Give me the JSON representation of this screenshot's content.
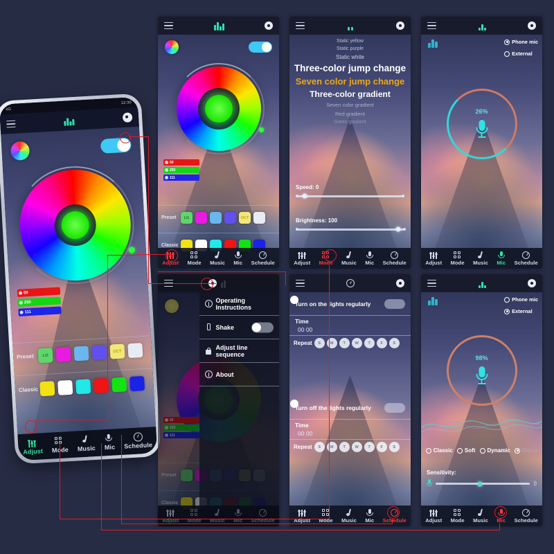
{
  "background_color": "#272c45",
  "accent_green": "#2ee39f",
  "accent_red": "#ff3b3b",
  "accent_orange": "#f0a810",
  "nav": {
    "items": [
      {
        "label": "Adjust",
        "icon": "sliders-icon"
      },
      {
        "label": "Mode",
        "icon": "grid-icon"
      },
      {
        "label": "Music",
        "icon": "music-note-icon"
      },
      {
        "label": "Mic",
        "icon": "microphone-icon"
      },
      {
        "label": "Schedule",
        "icon": "clock-icon"
      }
    ]
  },
  "big_phone": {
    "status_bar": {
      "left": "4G",
      "right": "12:30"
    },
    "screen": "adjust"
  },
  "adjust": {
    "rgb": [
      {
        "channel": "R",
        "value": "50",
        "color": "#e81515"
      },
      {
        "channel": "G",
        "value": "250",
        "color": "#15d615"
      },
      {
        "channel": "B",
        "value": "111",
        "color": "#1c26e8"
      }
    ],
    "preset_label": "Preset",
    "classic_label": "Classic",
    "preset_swatches": [
      {
        "color": "#5fd66b",
        "text": "LG"
      },
      {
        "color": "#e81ce0",
        "text": ""
      },
      {
        "color": "#6bb6ee",
        "text": ""
      },
      {
        "color": "#6150ee",
        "text": ""
      },
      {
        "color": "#f2e87a",
        "text": "OCT"
      },
      {
        "color": "#e8ecf2",
        "text": ""
      }
    ],
    "classic_swatches": [
      {
        "color": "#f2e214",
        "text": ""
      },
      {
        "color": "#ffffff",
        "text": ""
      },
      {
        "color": "#22e8e8",
        "text": ""
      },
      {
        "color": "#f01414",
        "text": ""
      },
      {
        "color": "#13e213",
        "text": ""
      },
      {
        "color": "#1a22e8",
        "text": ""
      }
    ],
    "power_toggle": "on",
    "color_wheel_icon": "color-wheel-icon"
  },
  "mode": {
    "items": [
      {
        "label": "Static yellow",
        "style": "dim"
      },
      {
        "label": "Static purple",
        "style": "dim"
      },
      {
        "label": "Static white",
        "style": "dim2"
      },
      {
        "label": "Three-color jump change",
        "style": "big"
      },
      {
        "label": "Seven color jump change",
        "style": "selected"
      },
      {
        "label": "Three-color gradient",
        "style": "big2"
      },
      {
        "label": "Seven color gradient",
        "style": "faint"
      },
      {
        "label": "Red gradient",
        "style": "faint"
      },
      {
        "label": "Green gradient",
        "style": "faint2"
      }
    ],
    "speed": {
      "label": "Speed:",
      "value": "0",
      "position_pct": 8
    },
    "brightness": {
      "label": "Brightness:",
      "value": "100",
      "position_pct": 94
    }
  },
  "mic_top": {
    "source_options": [
      {
        "label": "Phone mic",
        "selected": true
      },
      {
        "label": "External",
        "selected": false
      }
    ],
    "percent": "26%",
    "ring_color": "#2fd9d9",
    "eq_icon": "equalizer-icon",
    "mic_icon": "microphone-icon"
  },
  "mic_bottom": {
    "source_options": [
      {
        "label": "Phone mic",
        "selected": false
      },
      {
        "label": "External",
        "selected": true
      }
    ],
    "percent": "98%",
    "ring_color": "#cf8166",
    "eq_icon": "equalizer-icon",
    "mic_icon": "microphone-icon",
    "effect_options": [
      {
        "label": "Classic",
        "selected": false
      },
      {
        "label": "Soft",
        "selected": false
      },
      {
        "label": "Dynamic",
        "selected": false
      },
      {
        "label": "Disco",
        "selected": true
      }
    ],
    "sensitivity": {
      "label": "Sensitivity:",
      "position_pct": 47,
      "left_icon": "microphone-icon",
      "right_icon": "speaker-icon"
    }
  },
  "settings_menu": {
    "items": [
      {
        "label": "Operating Instructions",
        "icon": "question-circle-icon",
        "toggle": false
      },
      {
        "label": "Shake",
        "icon": "shake-icon",
        "toggle": true,
        "toggle_state": "off"
      },
      {
        "label": "Adjust line sequence",
        "icon": "lock-icon",
        "toggle": false
      },
      {
        "label": "About",
        "icon": "info-circle-icon",
        "toggle": false
      }
    ]
  },
  "schedule": {
    "turn_on": {
      "title": "Turn on the lights regularly",
      "toggle_state": "off",
      "time_label": "Time",
      "time_value": "00 00",
      "repeat_label": "Repeat",
      "days": [
        "S",
        "M",
        "T",
        "W",
        "T",
        "F",
        "S"
      ]
    },
    "turn_off": {
      "title": "Turn off the lights regularly",
      "toggle_state": "off",
      "time_label": "Time",
      "time_value": "00 00",
      "repeat_label": "Repeat",
      "days": [
        "S",
        "M",
        "T",
        "W",
        "T",
        "F",
        "S"
      ]
    }
  }
}
